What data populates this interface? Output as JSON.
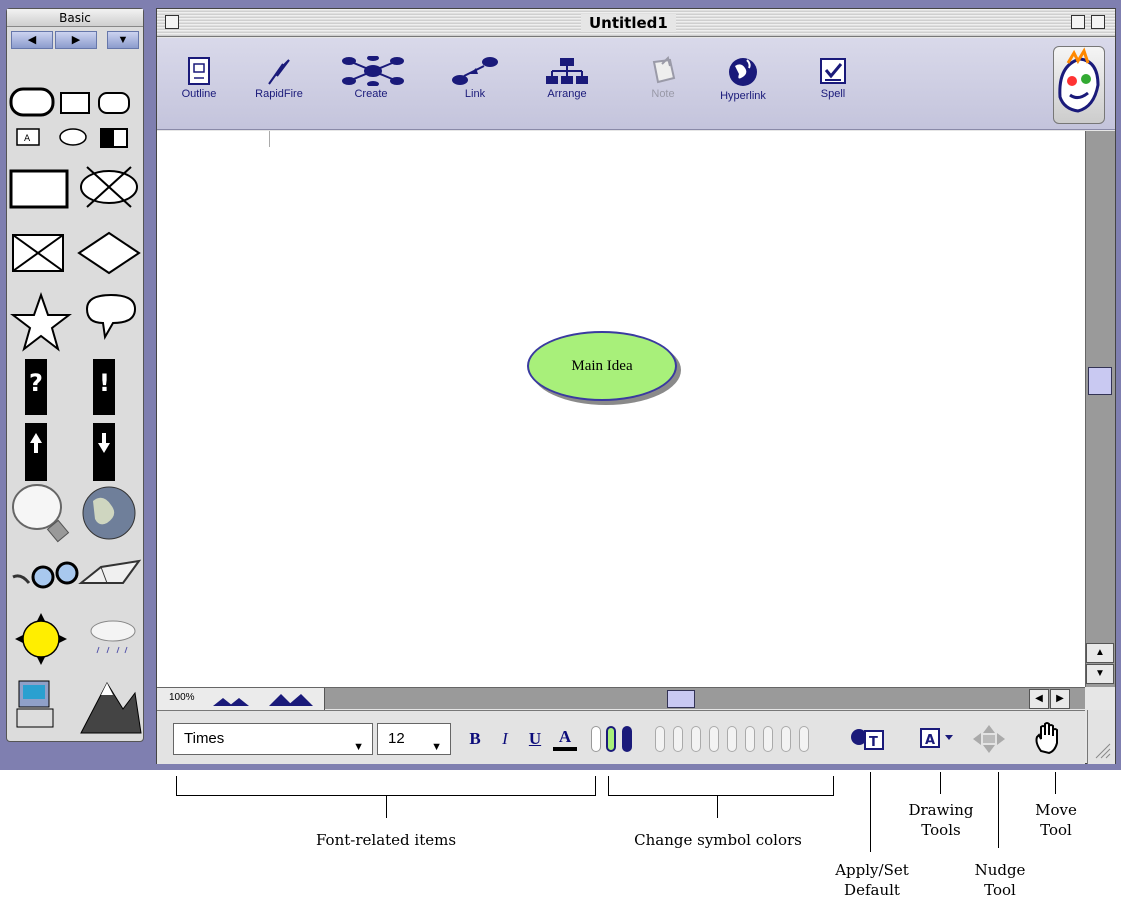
{
  "palette": {
    "title": "Basic",
    "nav": {
      "prev": "◀",
      "next": "▶",
      "menu": "▼"
    },
    "symbols": [
      "rounded-rect",
      "rect",
      "rounded-rect-small",
      "text-box",
      "oval",
      "half-shaded-rect",
      "large-rect",
      "crossed-oval",
      "crossed-rect",
      "diamond",
      "star",
      "speech-bubble",
      "question",
      "exclamation",
      "up-arrow",
      "down-arrow",
      "lightbulb",
      "globe",
      "eyeglasses",
      "book",
      "sun",
      "rain-cloud",
      "computer",
      "mountain"
    ]
  },
  "window": {
    "title": "Untitled1",
    "toolbar": [
      {
        "id": "outline",
        "label": "Outline",
        "enabled": true
      },
      {
        "id": "rapidfire",
        "label": "RapidFire",
        "enabled": true
      },
      {
        "id": "create",
        "label": "Create",
        "enabled": true
      },
      {
        "id": "link",
        "label": "Link",
        "enabled": true
      },
      {
        "id": "arrange",
        "label": "Arrange",
        "enabled": true
      },
      {
        "id": "note",
        "label": "Note",
        "enabled": false
      },
      {
        "id": "hyperlink",
        "label": "Hyperlink",
        "enabled": true
      },
      {
        "id": "spell",
        "label": "Spell",
        "enabled": true
      }
    ],
    "canvas": {
      "main_idea": "Main Idea"
    },
    "zoom": "100%"
  },
  "formatbar": {
    "font": "Times",
    "size": "12",
    "bold": "B",
    "italic": "I",
    "underline": "U",
    "text_color": "A",
    "symbol_color_count": 12
  },
  "annotations": {
    "font_related": "Font-related items",
    "change_colors": "Change symbol colors",
    "apply_set_default": [
      "Apply/Set",
      "Default"
    ],
    "drawing_tools": [
      "Drawing",
      "Tools"
    ],
    "nudge_tool": [
      "Nudge",
      "Tool"
    ],
    "move_tool": [
      "Move",
      "Tool"
    ]
  },
  "colors": {
    "accent": "#7f7fb0",
    "main_idea_fill": "#a8f07a",
    "main_idea_border": "#3a3aa0",
    "toolbar_text": "#1a1a7a"
  }
}
